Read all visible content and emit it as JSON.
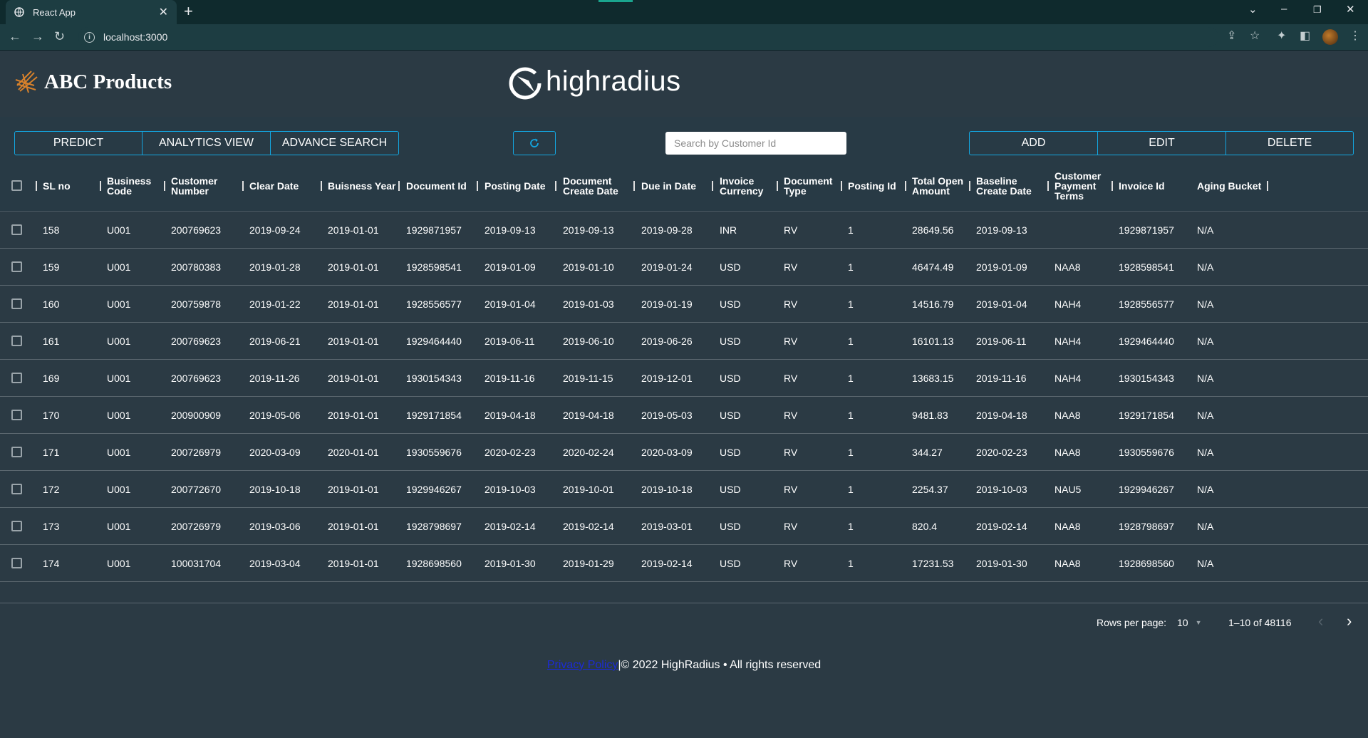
{
  "browser": {
    "tab_title": "React App",
    "url": "localhost:3000"
  },
  "header": {
    "brand_name": "ABC Products",
    "partner_logo_text": "highradius"
  },
  "toolbar": {
    "predict_label": "PREDICT",
    "analytics_label": "ANALYTICS VIEW",
    "advance_search_label": "ADVANCE SEARCH",
    "search_placeholder": "Search by Customer Id",
    "add_label": "ADD",
    "edit_label": "EDIT",
    "delete_label": "DELETE"
  },
  "table": {
    "columns": [
      [
        "SL no"
      ],
      [
        "Business",
        "Code"
      ],
      [
        "Customer",
        "Number"
      ],
      [
        "Clear Date"
      ],
      [
        "Buisness Year"
      ],
      [
        "Document Id"
      ],
      [
        "Posting Date"
      ],
      [
        "Document",
        "Create Date"
      ],
      [
        "Due in Date"
      ],
      [
        "Invoice",
        "Currency"
      ],
      [
        "Document",
        "Type"
      ],
      [
        "Posting Id"
      ],
      [
        "Total Open",
        "Amount"
      ],
      [
        "Baseline",
        "Create Date"
      ],
      [
        "Customer",
        "Payment",
        "Terms"
      ],
      [
        "Invoice Id"
      ],
      [
        "Aging Bucket"
      ]
    ],
    "rows": [
      [
        "158",
        "U001",
        "200769623",
        "2019-09-24",
        "2019-01-01",
        "1929871957",
        "2019-09-13",
        "2019-09-13",
        "2019-09-28",
        "INR",
        "RV",
        "1",
        "28649.56",
        "2019-09-13",
        "",
        "1929871957",
        "N/A"
      ],
      [
        "159",
        "U001",
        "200780383",
        "2019-01-28",
        "2019-01-01",
        "1928598541",
        "2019-01-09",
        "2019-01-10",
        "2019-01-24",
        "USD",
        "RV",
        "1",
        "46474.49",
        "2019-01-09",
        "NAA8",
        "1928598541",
        "N/A"
      ],
      [
        "160",
        "U001",
        "200759878",
        "2019-01-22",
        "2019-01-01",
        "1928556577",
        "2019-01-04",
        "2019-01-03",
        "2019-01-19",
        "USD",
        "RV",
        "1",
        "14516.79",
        "2019-01-04",
        "NAH4",
        "1928556577",
        "N/A"
      ],
      [
        "161",
        "U001",
        "200769623",
        "2019-06-21",
        "2019-01-01",
        "1929464440",
        "2019-06-11",
        "2019-06-10",
        "2019-06-26",
        "USD",
        "RV",
        "1",
        "16101.13",
        "2019-06-11",
        "NAH4",
        "1929464440",
        "N/A"
      ],
      [
        "169",
        "U001",
        "200769623",
        "2019-11-26",
        "2019-01-01",
        "1930154343",
        "2019-11-16",
        "2019-11-15",
        "2019-12-01",
        "USD",
        "RV",
        "1",
        "13683.15",
        "2019-11-16",
        "NAH4",
        "1930154343",
        "N/A"
      ],
      [
        "170",
        "U001",
        "200900909",
        "2019-05-06",
        "2019-01-01",
        "1929171854",
        "2019-04-18",
        "2019-04-18",
        "2019-05-03",
        "USD",
        "RV",
        "1",
        "9481.83",
        "2019-04-18",
        "NAA8",
        "1929171854",
        "N/A"
      ],
      [
        "171",
        "U001",
        "200726979",
        "2020-03-09",
        "2020-01-01",
        "1930559676",
        "2020-02-23",
        "2020-02-24",
        "2020-03-09",
        "USD",
        "RV",
        "1",
        "344.27",
        "2020-02-23",
        "NAA8",
        "1930559676",
        "N/A"
      ],
      [
        "172",
        "U001",
        "200772670",
        "2019-10-18",
        "2019-01-01",
        "1929946267",
        "2019-10-03",
        "2019-10-01",
        "2019-10-18",
        "USD",
        "RV",
        "1",
        "2254.37",
        "2019-10-03",
        "NAU5",
        "1929946267",
        "N/A"
      ],
      [
        "173",
        "U001",
        "200726979",
        "2019-03-06",
        "2019-01-01",
        "1928798697",
        "2019-02-14",
        "2019-02-14",
        "2019-03-01",
        "USD",
        "RV",
        "1",
        "820.4",
        "2019-02-14",
        "NAA8",
        "1928798697",
        "N/A"
      ],
      [
        "174",
        "U001",
        "100031704",
        "2019-03-04",
        "2019-01-01",
        "1928698560",
        "2019-01-30",
        "2019-01-29",
        "2019-02-14",
        "USD",
        "RV",
        "1",
        "17231.53",
        "2019-01-30",
        "NAA8",
        "1928698560",
        "N/A"
      ]
    ]
  },
  "pagination": {
    "rows_per_page_label": "Rows per page:",
    "rows_per_page_value": "10",
    "range_text": "1–10 of 48116"
  },
  "footer": {
    "privacy_link": "Privacy Policy",
    "copyright": "|© 2022 HighRadius • All rights reserved"
  },
  "colors": {
    "background": "#2b3a44",
    "accent_border": "#13a6e0",
    "brand_logo": "#d9822b"
  },
  "icons": {
    "tab_favicon": "globe-icon",
    "refresh": "refresh-icon",
    "brand": "abc-logo-icon",
    "partner": "highradius-logo-icon"
  }
}
